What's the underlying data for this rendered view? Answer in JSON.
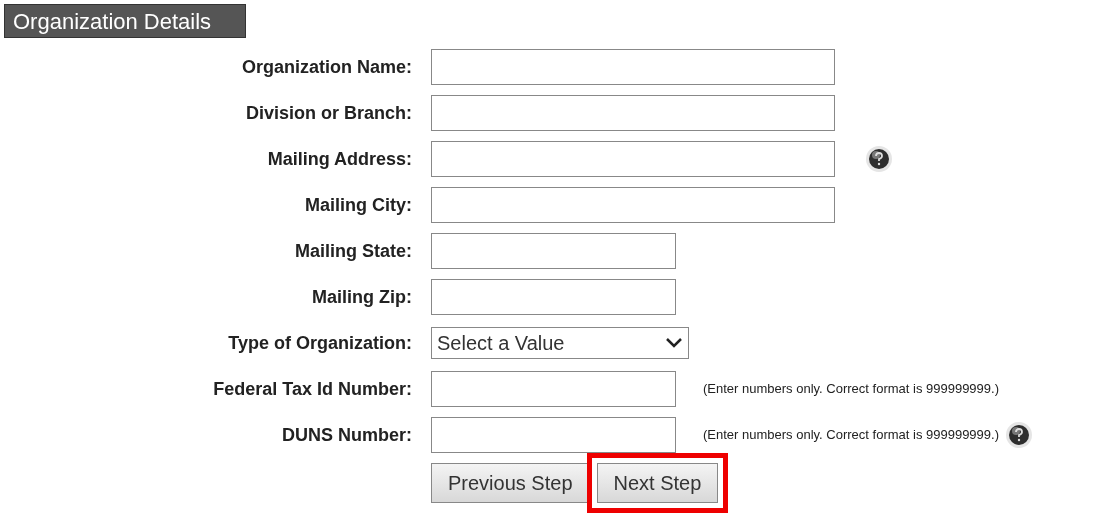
{
  "header": {
    "title": "Organization Details"
  },
  "fields": [
    {
      "label": "Organization Name:",
      "kind": "long",
      "help": false
    },
    {
      "label": "Division or Branch:",
      "kind": "long",
      "help": false
    },
    {
      "label": "Mailing Address:",
      "kind": "long",
      "help": true
    },
    {
      "label": "Mailing City:",
      "kind": "long",
      "help": false
    },
    {
      "label": "Mailing State:",
      "kind": "short",
      "help": false
    },
    {
      "label": "Mailing Zip:",
      "kind": "short",
      "help": false
    },
    {
      "label": "Type of Organization:",
      "kind": "select",
      "value": "Select a Value",
      "help": false
    },
    {
      "label": "Federal Tax Id Number:",
      "kind": "short",
      "hint": "(Enter numbers only. Correct format is 999999999.)",
      "help": false
    },
    {
      "label": "DUNS Number:",
      "kind": "short",
      "hint": "(Enter numbers only. Correct format is 999999999.)",
      "help": true
    }
  ],
  "buttons": [
    {
      "label": "Previous Step",
      "highlighted": false
    },
    {
      "label": "Next Step",
      "highlighted": true
    }
  ]
}
